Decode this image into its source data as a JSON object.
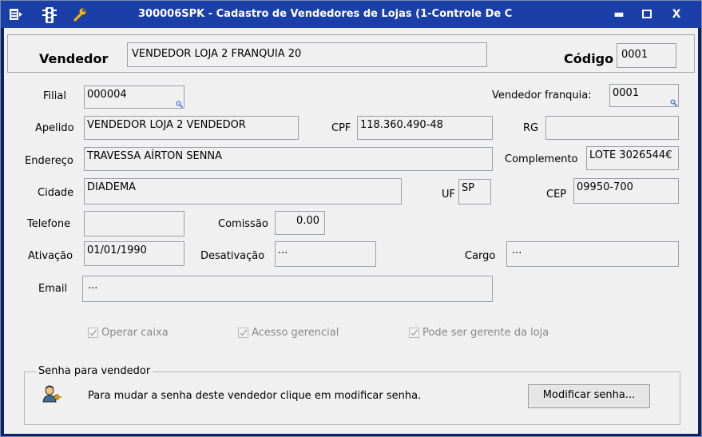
{
  "window": {
    "title": "300006SPK - Cadastro de Vendedores de Lojas (1-Controle De C",
    "minimize": "▬",
    "maximize": "□",
    "close": "X"
  },
  "header": {
    "vendedor_label": "Vendedor",
    "vendedor_value": "VENDEDOR LOJA 2 FRANQUIA 20",
    "codigo_label": "Código",
    "codigo_value": "0001"
  },
  "fields": {
    "filial": {
      "label": "Filial",
      "value": "000004"
    },
    "vendedor_franquia": {
      "label": "Vendedor franquia:",
      "value": "0001"
    },
    "apelido": {
      "label": "Apelido",
      "value": "VENDEDOR LOJA 2 VENDEDOR"
    },
    "cpf": {
      "label": "CPF",
      "value": "118.360.490-48"
    },
    "rg": {
      "label": "RG",
      "value": ""
    },
    "endereco": {
      "label": "Endereço",
      "value": "TRAVESSA AÍRTON SENNA"
    },
    "complemento": {
      "label": "Complemento",
      "value": "LOTE 3026544€"
    },
    "cidade": {
      "label": "Cidade",
      "value": "DIADEMA"
    },
    "uf": {
      "label": "UF",
      "value": "SP"
    },
    "cep": {
      "label": "CEP",
      "value": "09950-700"
    },
    "telefone": {
      "label": "Telefone",
      "value": ""
    },
    "comissao": {
      "label": "Comissão",
      "value": "0.00"
    },
    "ativacao": {
      "label": "Ativação",
      "value": "01/01/1990"
    },
    "desativacao": {
      "label": "Desativação",
      "value": "···"
    },
    "cargo": {
      "label": "Cargo",
      "value": "···"
    },
    "email": {
      "label": "Email",
      "value": "···"
    }
  },
  "checkboxes": {
    "operar_caixa": {
      "label": "Operar caixa",
      "checked": true
    },
    "acesso_gerencial": {
      "label": "Acesso gerencial",
      "checked": true
    },
    "pode_ser_gerente": {
      "label": "Pode ser gerente da loja",
      "checked": true
    }
  },
  "senha": {
    "group_title": "Senha para vendedor",
    "message": "Para mudar a senha deste vendedor clique em modificar senha.",
    "button": "Modificar senha..."
  },
  "colors": {
    "titlebar": "#1a3fa8",
    "form_bg": "#f0f0f0",
    "disabled_text": "#888888"
  },
  "icons": [
    "menu-icon",
    "traffic-light-icon",
    "wrench-icon",
    "lookup-icon",
    "user-key-icon",
    "checkmark-icon"
  ]
}
